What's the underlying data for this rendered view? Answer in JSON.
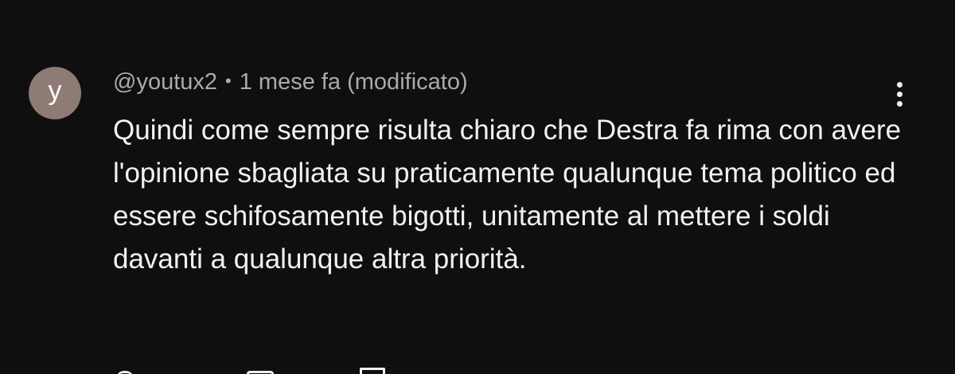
{
  "comment": {
    "avatar_letter": "y",
    "avatar_color": "#8d7b74",
    "author": "@youtux2",
    "separator": "•",
    "time": "1 mese fa (modificato)",
    "text": "Quindi come sempre risulta chiaro che Destra fa rima con avere l'opinione sbagliata su praticamente qualunque tema politico ed essere schifosamente bigotti, unitamente al mettere i soldi davanti a qualunque altra priorità.",
    "menu_icon": "more-vert-icon"
  },
  "actions": {
    "like_icon": "thumb-up-icon",
    "dislike_icon": "thumb-down-icon",
    "reply_icon": "reply-icon"
  },
  "colors": {
    "background": "#0f0f0f",
    "text_primary": "#f1f1f1",
    "text_secondary": "#aaaaaa"
  }
}
